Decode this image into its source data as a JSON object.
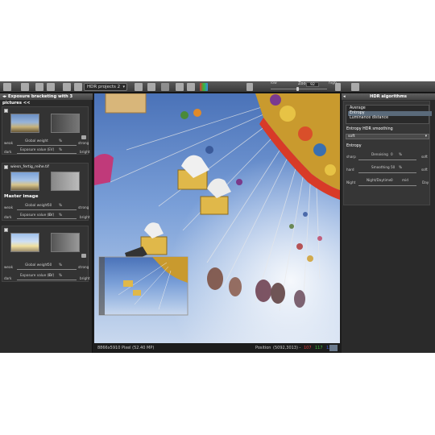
{
  "toolbar": {
    "project_select": "HDR projects 2",
    "zoom_label": "Zoom",
    "zoom_value": "92",
    "low_label": "low",
    "high_label": "high",
    "zoom_low": "Low",
    "zoom_high": "High"
  },
  "left_panel": {
    "title": "Exposure bracketing with 3 pictures",
    "global_weight_label": "Global weight",
    "global_weight_value": "50",
    "percent": "%",
    "exposure_label": "Exposure value (EV)",
    "exposure_value": "0",
    "weak": "weak",
    "strong": "strong",
    "dark": "dark",
    "bright": "bright",
    "filename": "wiesn_fertig_reihe.tif",
    "master_label": "Master image"
  },
  "right_panel": {
    "title": "HDR algorithms",
    "algorithms": [
      "Average",
      "Entropy",
      "Luminance distance"
    ],
    "selected_algorithm": "Entropy",
    "smoothing_section": "Entropy HDR smoothing",
    "smoothing_value": "soft",
    "entropy_section": "Entropy",
    "params": [
      {
        "left": "sharp",
        "name": "Denoising",
        "value": "0",
        "unit": "%",
        "right": "soft"
      },
      {
        "left": "hard",
        "name": "Smoothing",
        "value": "50",
        "unit": "%",
        "right": "soft"
      },
      {
        "left": "Night",
        "name": "Night/Daytime",
        "value": "0",
        "unit": "mid",
        "right": "Day"
      }
    ]
  },
  "status": {
    "dimensions": "8866x5910 Pixel (52.40 MP)",
    "position_label": "Position",
    "position_value": "(5092,3013) -",
    "r": "107",
    "g": "117",
    "b": "125",
    "r_color": "#e04040",
    "g_color": "#40c040",
    "b_color": "#4060e0"
  }
}
